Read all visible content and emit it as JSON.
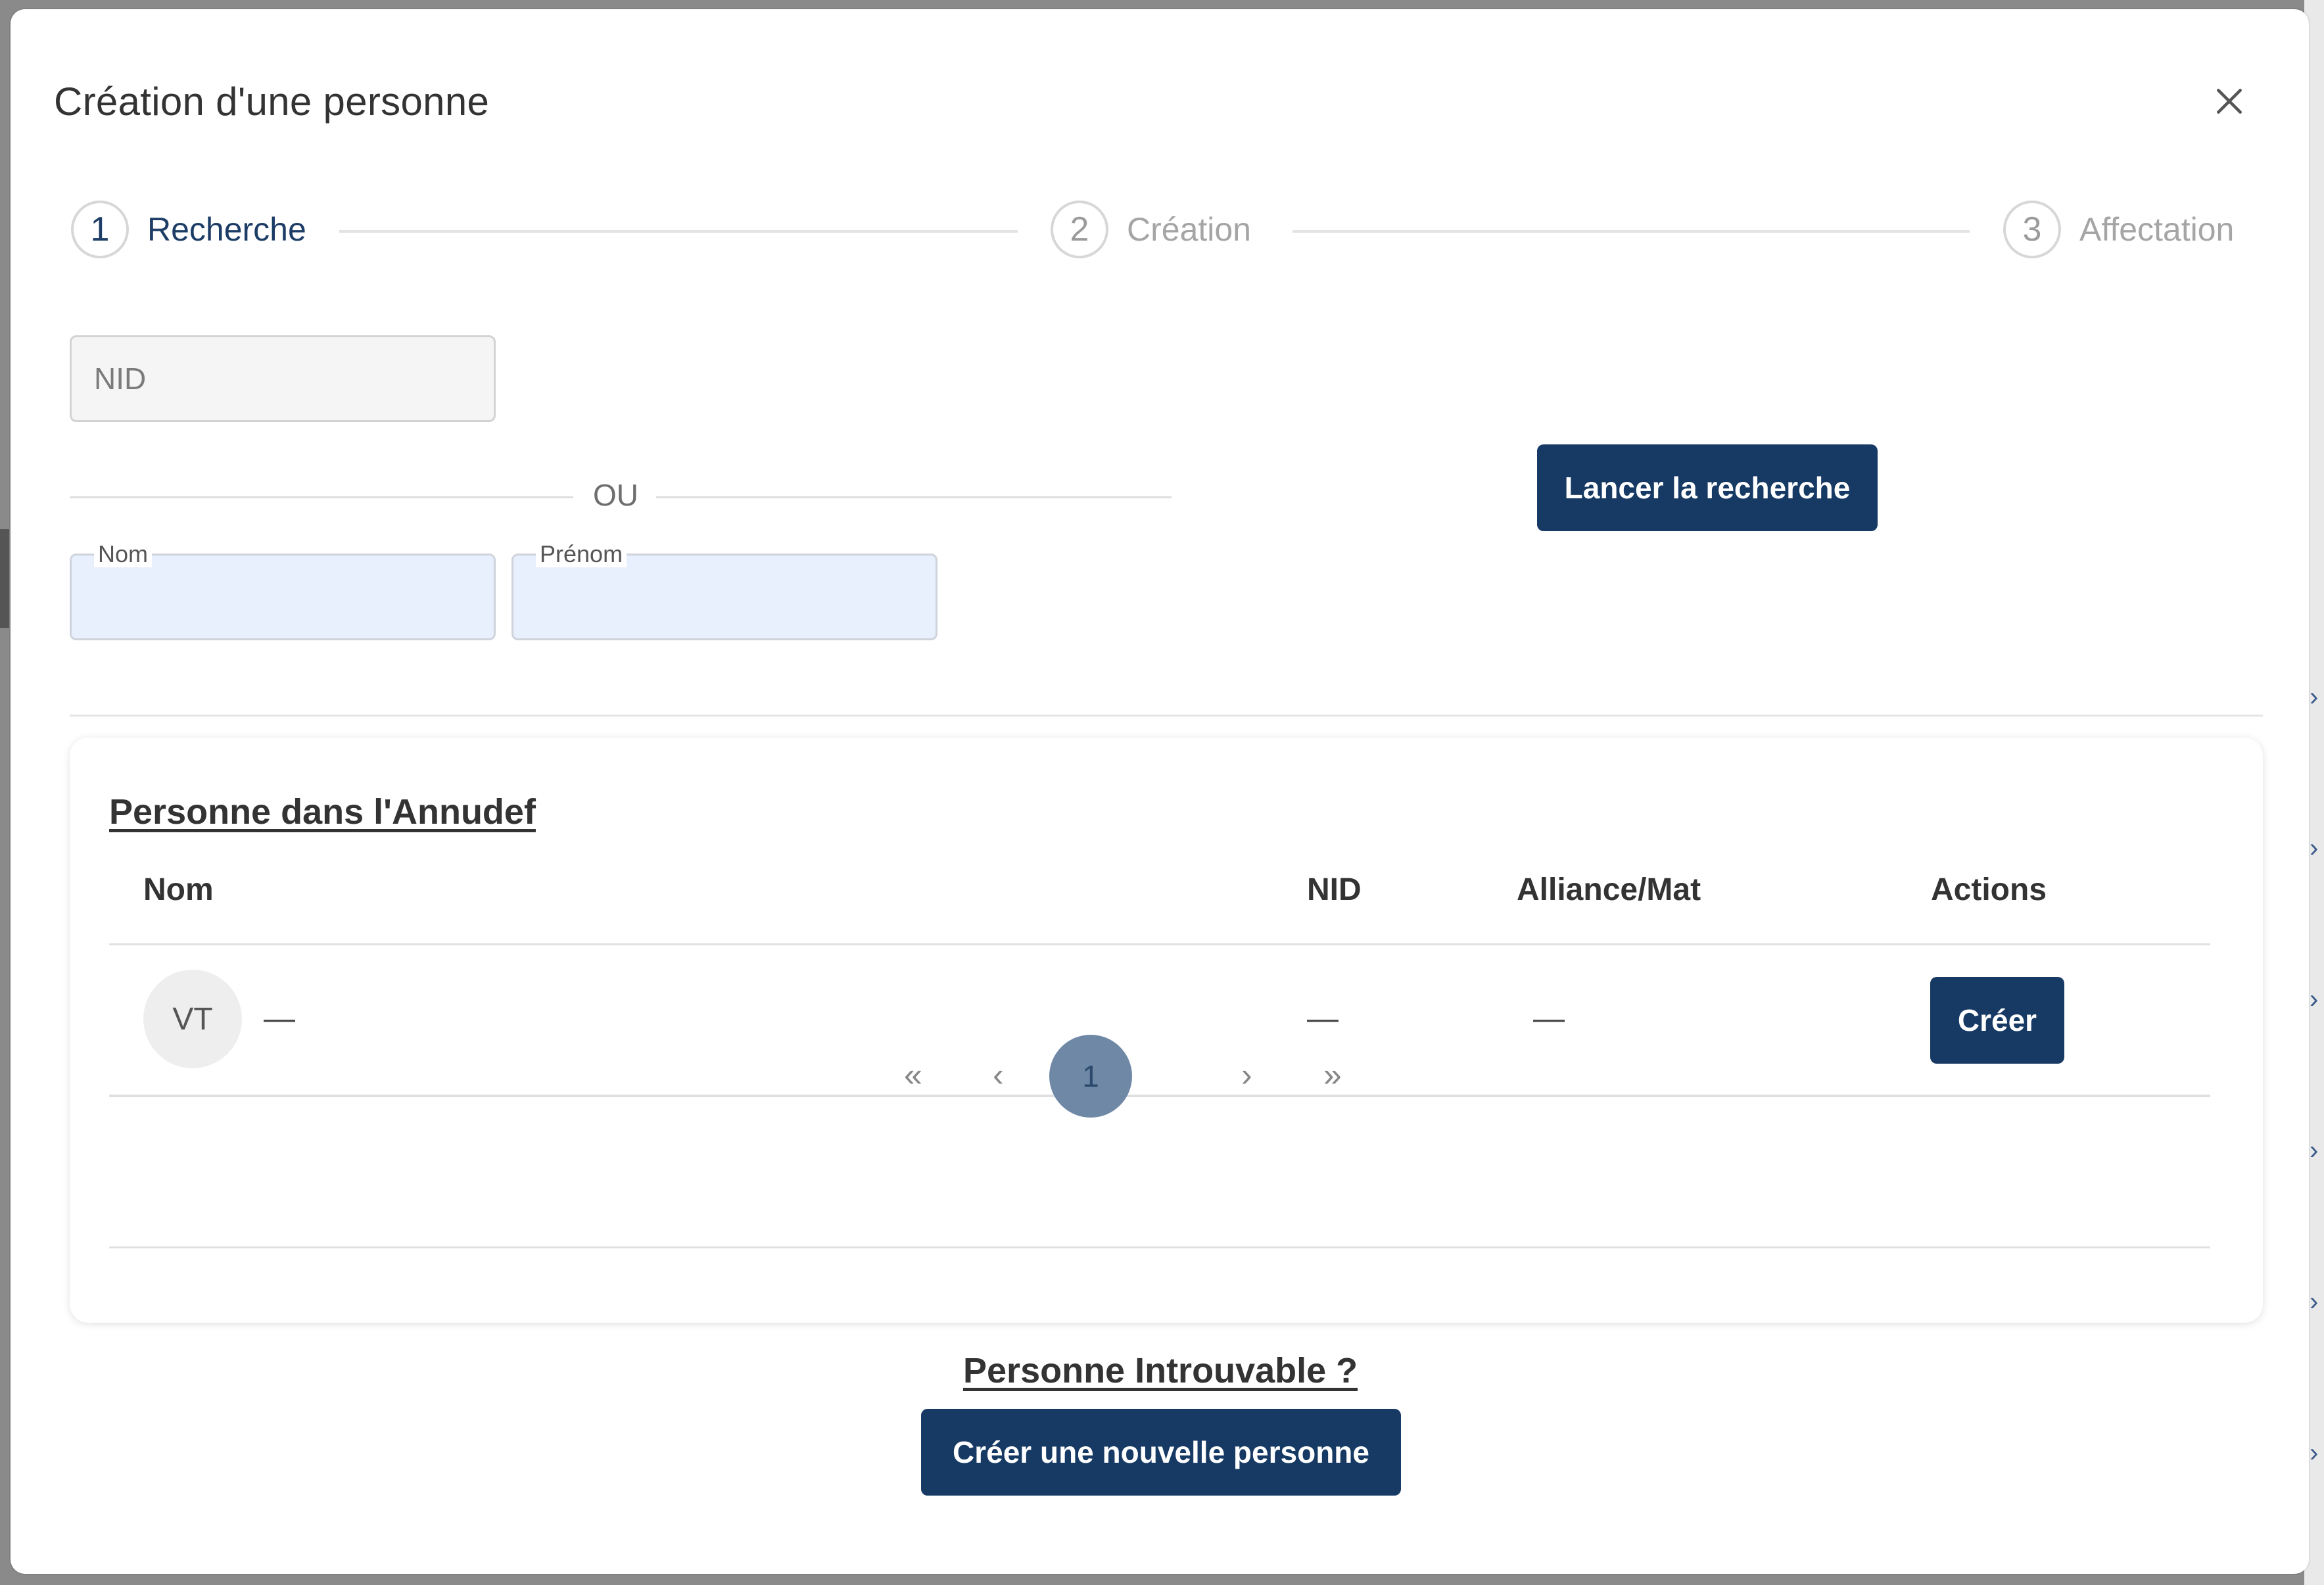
{
  "modal": {
    "title": "Création d'une personne",
    "close_icon": "close-icon"
  },
  "stepper": {
    "steps": [
      {
        "number": "1",
        "label": "Recherche",
        "active": true
      },
      {
        "number": "2",
        "label": "Création",
        "active": false
      },
      {
        "number": "3",
        "label": "Affectation",
        "active": false
      }
    ]
  },
  "search": {
    "nid_placeholder": "NID",
    "nid_value": "",
    "or_label": "OU",
    "nom_label": "Nom",
    "nom_value": "",
    "prenom_label": "Prénom",
    "prenom_value": "",
    "launch_button": "Lancer la recherche"
  },
  "results": {
    "title": "Personne dans l'Annudef",
    "columns": [
      "Nom",
      "NID",
      "Alliance/Mat",
      "Actions"
    ],
    "rows": [
      {
        "initials": "VT",
        "nom": "—",
        "nid": "—",
        "alliance": "—",
        "action": "Créer"
      }
    ],
    "pagination": {
      "first": "«",
      "prev": "‹",
      "current": "1",
      "next": "›",
      "last": "»"
    }
  },
  "footer": {
    "not_found": "Personne Introuvable ?",
    "create_button": "Créer une nouvelle personne"
  },
  "colors": {
    "primary": "#163a64",
    "active_step": "#1d3d66",
    "input_blue": "#e8effd",
    "page_current": "#6e88a6"
  }
}
